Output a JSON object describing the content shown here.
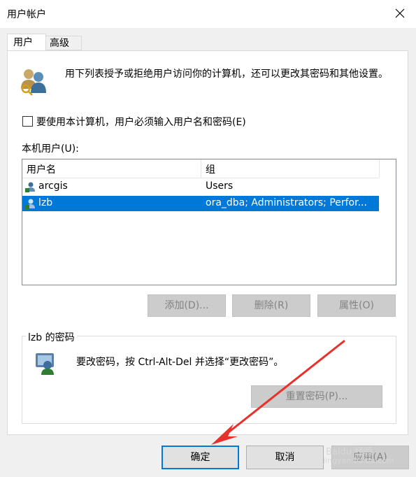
{
  "window": {
    "title": "用户帐户"
  },
  "tabs": [
    {
      "label": "用户"
    },
    {
      "label": "高级"
    }
  ],
  "intro": {
    "text": "用下列表授予或拒绝用户访问你的计算机，还可以更改其密码和其他设置。"
  },
  "require_password": {
    "label": "要使用本计算机，用户必须输入用户名和密码(E)",
    "checked": false
  },
  "users_list": {
    "label": "本机用户(U):",
    "columns": [
      "用户名",
      "组"
    ],
    "rows": [
      {
        "name": "arcgis",
        "group": "Users",
        "selected": false
      },
      {
        "name": "lzb",
        "group": "ora_dba; Administrators; Perfor...",
        "selected": true
      }
    ]
  },
  "list_buttons": {
    "add": "添加(D)...",
    "remove": "删除(R)",
    "properties": "属性(O)"
  },
  "password_group": {
    "title": "lzb 的密码",
    "message": "要改密码，按 Ctrl-Alt-Del 并选择“更改密码”。",
    "reset_button": "重置密码(P)..."
  },
  "footer": {
    "ok": "确定",
    "cancel": "取消",
    "apply": "应用(A)"
  },
  "watermark": {
    "line1": "Baidu 经验",
    "line2": "jingyan.baidu.com"
  },
  "colors": {
    "selection": "#0078d7",
    "annotation_arrow": "#e8312a"
  }
}
